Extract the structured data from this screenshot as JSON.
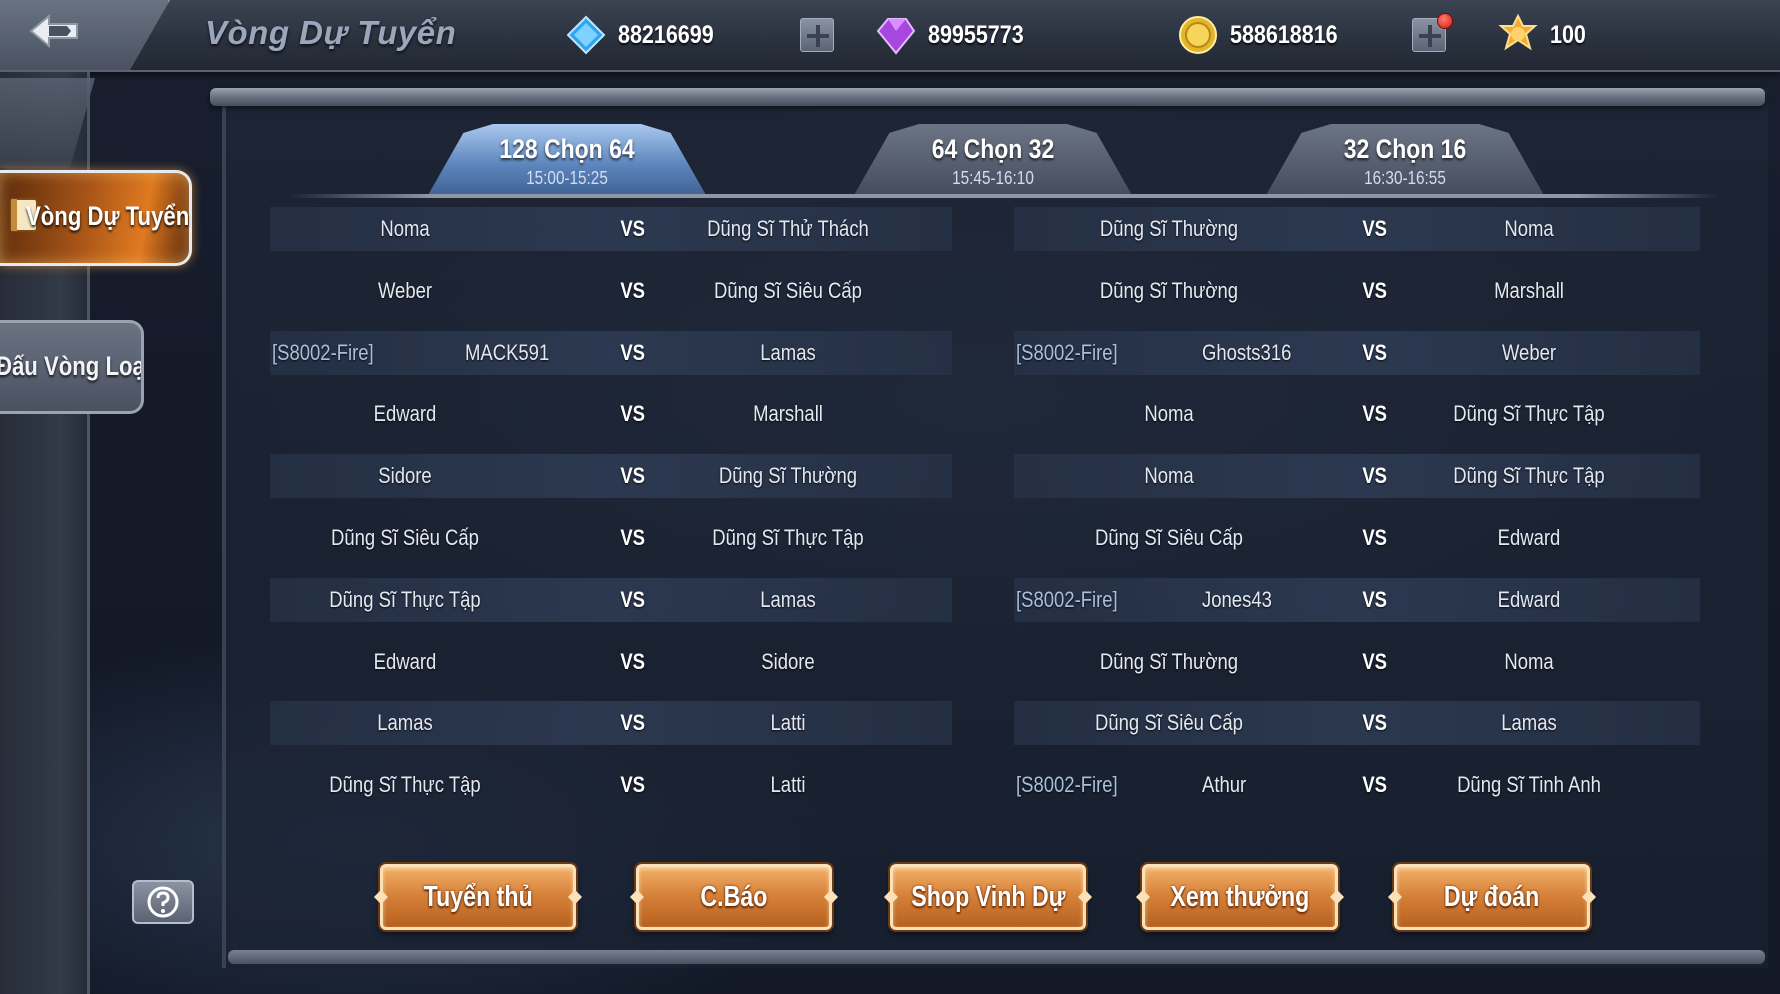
{
  "header": {
    "title": "Vòng Dự Tuyển",
    "currencies": [
      {
        "icon": "blue-diamond-icon",
        "value": "88216699"
      },
      {
        "icon": "purple-gem-icon",
        "value": "89955773"
      },
      {
        "icon": "gold-coin-icon",
        "value": "588618816"
      },
      {
        "icon": "gold-medal-icon",
        "value": "100"
      }
    ]
  },
  "sidebar": {
    "items": [
      {
        "label": "Vòng Dự Tuyển",
        "active": true
      },
      {
        "label": "Đấu Vòng Loại",
        "active": false
      }
    ]
  },
  "rounds": [
    {
      "name": "128 Chọn 64",
      "time": "15:00-15:25",
      "active": true
    },
    {
      "name": "64 Chọn 32",
      "time": "15:45-16:10",
      "active": false
    },
    {
      "name": "32 Chọn 16",
      "time": "16:30-16:55",
      "active": false
    }
  ],
  "vs_label": "VS",
  "matches_left": [
    {
      "tag": "",
      "p1": "Noma",
      "p2": "Dũng Sĩ Thử Thách"
    },
    {
      "tag": "",
      "p1": "Weber",
      "p2": "Dũng Sĩ Siêu Cấp"
    },
    {
      "tag": "[S8002-Fire]",
      "p1": "MACK591",
      "p2": "Lamas"
    },
    {
      "tag": "",
      "p1": "Edward",
      "p2": "Marshall"
    },
    {
      "tag": "",
      "p1": "Sidore",
      "p2": "Dũng Sĩ Thường"
    },
    {
      "tag": "",
      "p1": "Dũng Sĩ Siêu Cấp",
      "p2": "Dũng Sĩ Thực Tập"
    },
    {
      "tag": "",
      "p1": "Dũng Sĩ Thực Tập",
      "p2": "Lamas"
    },
    {
      "tag": "",
      "p1": "Edward",
      "p2": "Sidore"
    },
    {
      "tag": "",
      "p1": "Lamas",
      "p2": "Latti"
    },
    {
      "tag": "",
      "p1": "Dũng Sĩ Thực Tập",
      "p2": "Latti"
    }
  ],
  "matches_right": [
    {
      "tag": "",
      "p1": "Dũng Sĩ Thường",
      "p2": "Noma"
    },
    {
      "tag": "",
      "p1": "Dũng Sĩ Thường",
      "p2": "Marshall"
    },
    {
      "tag": "[S8002-Fire]",
      "p1": "Ghosts316",
      "p2": "Weber"
    },
    {
      "tag": "",
      "p1": "Noma",
      "p2": "Dũng Sĩ Thực Tập"
    },
    {
      "tag": "",
      "p1": "Noma",
      "p2": "Dũng Sĩ Thực Tập"
    },
    {
      "tag": "",
      "p1": "Dũng Sĩ Siêu Cấp",
      "p2": "Edward"
    },
    {
      "tag": "[S8002-Fire]",
      "p1": "Jones43",
      "p2": "Edward"
    },
    {
      "tag": "",
      "p1": "Dũng Sĩ Thường",
      "p2": "Noma"
    },
    {
      "tag": "",
      "p1": "Dũng Sĩ Siêu Cấp",
      "p2": "Lamas"
    },
    {
      "tag": "[S8002-Fire]",
      "p1": "Athur",
      "p2": "Dũng Sĩ Tinh Anh"
    }
  ],
  "actions": [
    {
      "label": "Tuyển thủ"
    },
    {
      "label": "C.Báo"
    },
    {
      "label": "Shop Vinh Dự"
    },
    {
      "label": "Xem thưởng"
    },
    {
      "label": "Dự đoán"
    }
  ],
  "colors": {
    "accent_orange": "#d7833b",
    "active_tab_blue": "#5d86bd",
    "tag_blue": "#a9bfdc"
  }
}
